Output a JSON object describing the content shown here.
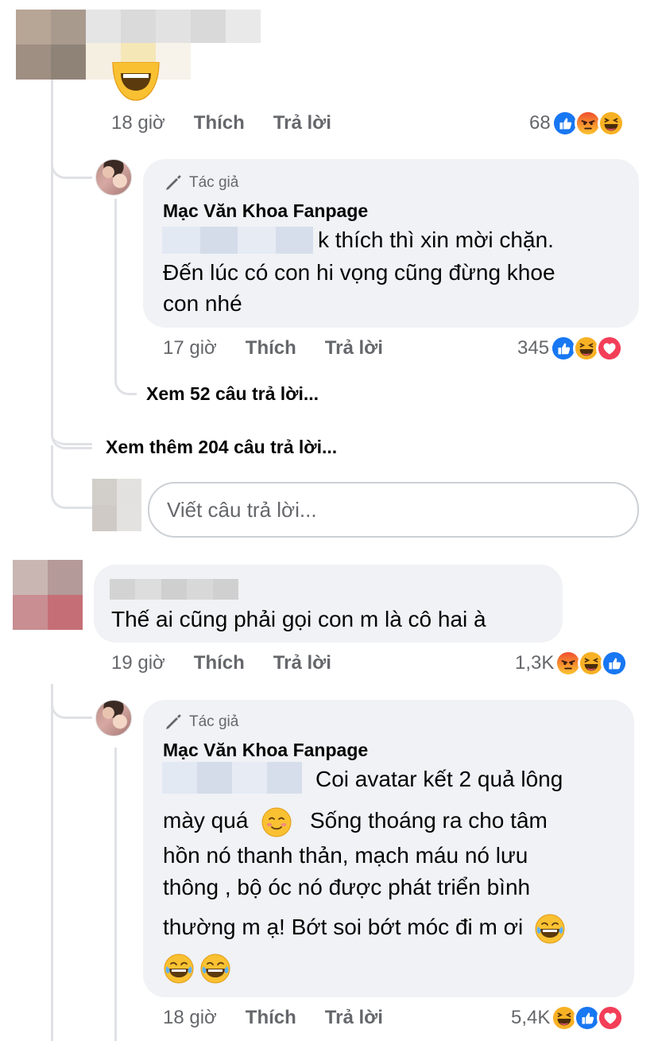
{
  "comments": {
    "c1": {
      "time": "18 giờ",
      "like_label": "Thích",
      "reply_label": "Trả lời",
      "reaction_count": "68"
    },
    "r1": {
      "author_badge": "Tác giả",
      "author_name": "Mạc Văn Khoa Fanpage",
      "text_line1": "k thích thì xin mời chặn.",
      "text_line2": "Đến lúc có con hi vọng cũng đừng khoe",
      "text_line3": "con nhé",
      "time": "17 giờ",
      "like_label": "Thích",
      "reply_label": "Trả lời",
      "reaction_count": "345"
    },
    "see_replies": "Xem 52 câu trả lời...",
    "see_more": "Xem thêm 204 câu trả lời...",
    "reply_placeholder": "Viết câu trả lời...",
    "c2": {
      "text": "Thế ai cũng phải gọi con m là cô hai à",
      "time": "19 giờ",
      "like_label": "Thích",
      "reply_label": "Trả lời",
      "reaction_count": "1,3K"
    },
    "r2": {
      "author_badge": "Tác giả",
      "author_name": "Mạc Văn Khoa Fanpage",
      "line1": "Coi avatar kết 2 quả lông",
      "line2a": "mày quá",
      "line2b": "Sống thoáng ra cho tâm",
      "line3": "hồn nó thanh thản, mạch máu nó lưu",
      "line4": "thông , bộ óc nó được phát triển bình",
      "line5": "thường m ạ! Bớt soi bớt móc đi m ơi",
      "time": "18 giờ",
      "like_label": "Thích",
      "reply_label": "Trả lời",
      "reaction_count": "5,4K"
    }
  },
  "colors": {
    "like_blue": "#1877f2",
    "angry_orange": "#f0502f",
    "haha_yellow": "#f7b125",
    "love_red": "#f33e58",
    "bubble_gray": "#f0f2f5",
    "thread_line": "#dfe1e5",
    "meta_gray": "#65676b"
  },
  "icons": [
    "like-reaction-icon",
    "angry-reaction-icon",
    "haha-reaction-icon",
    "love-reaction-icon",
    "pen-icon",
    "smiling-emoji-icon",
    "laughing-tears-emoji-icon"
  ]
}
